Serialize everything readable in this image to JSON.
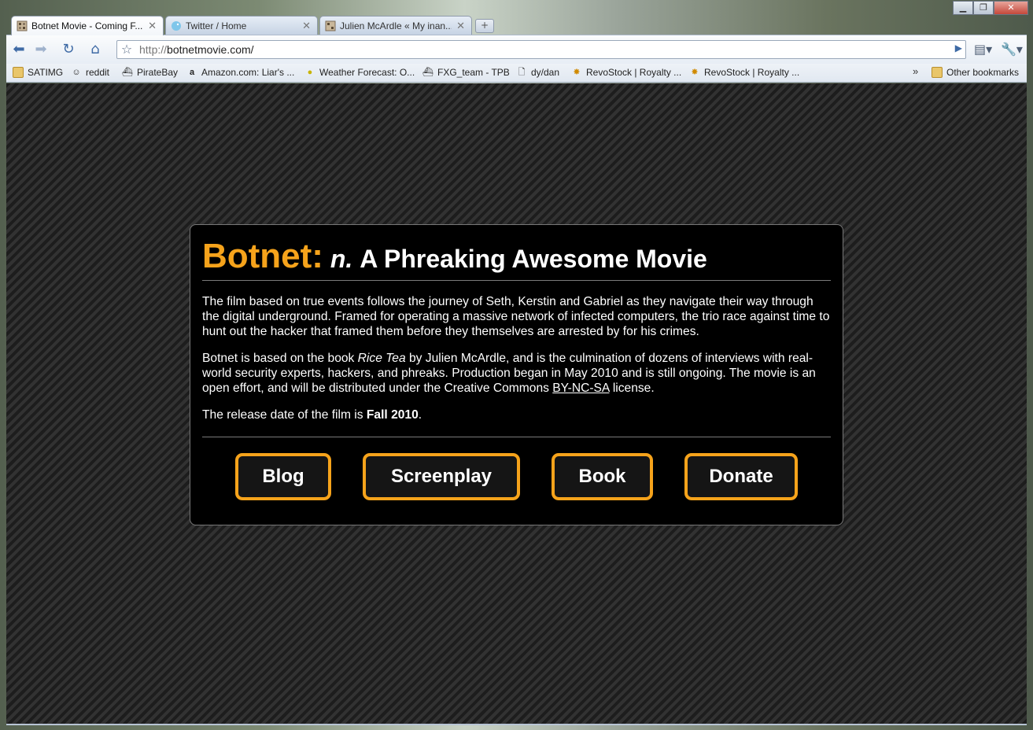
{
  "browser": {
    "tabs": [
      {
        "title": "Botnet Movie - Coming F...",
        "active": true,
        "icon": "page-grid-icon"
      },
      {
        "title": "Twitter / Home",
        "active": false,
        "icon": "twitter-bird-icon"
      },
      {
        "title": "Julien McArdle « My inan...",
        "active": false,
        "icon": "page-grid-icon"
      }
    ],
    "new_tab_label": "+",
    "url_protocol": "http://",
    "url_host": "botnetmovie.com/",
    "bookmarks": [
      {
        "label": "SATIMG",
        "icon": "folder-icon"
      },
      {
        "label": "reddit",
        "icon": "reddit-icon"
      },
      {
        "label": "PirateBay",
        "icon": "pirate-ship-icon"
      },
      {
        "label": "Amazon.com: Liar's ...",
        "icon": "amazon-icon"
      },
      {
        "label": "Weather Forecast: O...",
        "icon": "weather-icon"
      },
      {
        "label": "FXG_team - TPB",
        "icon": "pirate-ship-icon"
      },
      {
        "label": "dy/dan",
        "icon": "page-icon"
      },
      {
        "label": "RevoStock | Royalty ...",
        "icon": "revostock-icon"
      },
      {
        "label": "RevoStock | Royalty ...",
        "icon": "revostock-icon"
      }
    ],
    "other_bookmarks": "Other bookmarks"
  },
  "page": {
    "title_brand": "Botnet:",
    "title_pos": "n.",
    "title_rest": "A Phreaking Awesome Movie",
    "para1": "The film based on true events follows the journey of Seth, Kerstin and Gabriel as they navigate their way through the digital underground. Framed for operating a massive network of infected computers, the trio race against time to hunt out the hacker that framed them before they themselves are arrested by for his crimes.",
    "para2_a": "Botnet is based on the book ",
    "para2_book": "Rice Tea",
    "para2_b": " by Julien McArdle, and is the culmination of dozens of interviews with real-world security experts, hackers, and phreaks. Production began in May 2010 and is still ongoing. The movie is an open effort, and will be distributed under the Creative Commons ",
    "license_link": "BY-NC-SA",
    "para2_c": " license.",
    "para3_a": "The release date of the film is ",
    "release_date": "Fall 2010",
    "para3_b": ".",
    "buttons": [
      "Blog",
      "Screenplay",
      "Book",
      "Donate"
    ],
    "accent_color": "#f6a31b"
  }
}
